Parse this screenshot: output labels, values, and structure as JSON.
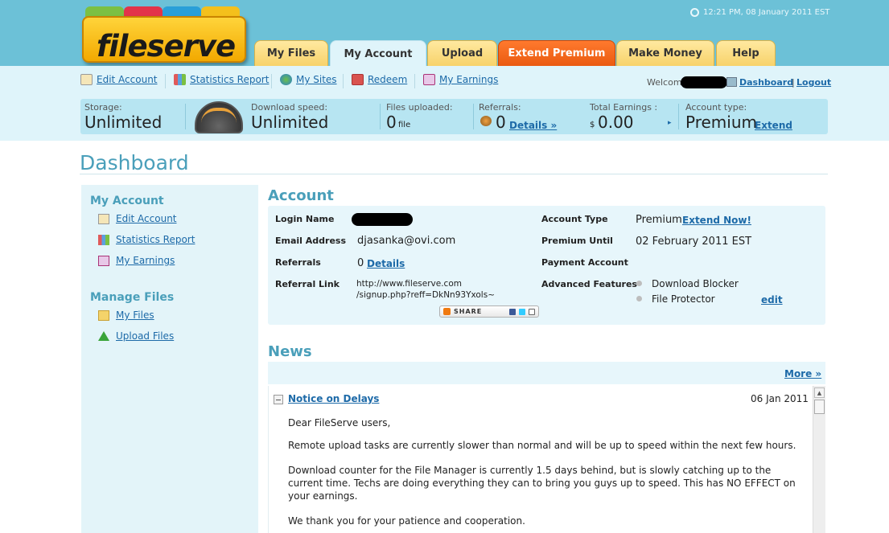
{
  "header": {
    "logo_text": "fileserve",
    "clock": "12:21 PM, 08 January 2011 EST",
    "tabs": [
      {
        "label": "My Files"
      },
      {
        "label": "My Account"
      },
      {
        "label": "Upload"
      },
      {
        "label": "Extend Premium"
      },
      {
        "label": "Make Money"
      },
      {
        "label": "Help"
      }
    ]
  },
  "subnav": {
    "links": [
      {
        "label": "Edit Account"
      },
      {
        "label": "Statistics Report"
      },
      {
        "label": "My Sites"
      },
      {
        "label": "Redeem"
      },
      {
        "label": "My Earnings"
      }
    ],
    "welcome": "Welcome",
    "dashboard": "Dashboard",
    "separator": "|",
    "logout": "Logout"
  },
  "stats": {
    "storage_label": "Storage:",
    "storage_value": "Unlimited",
    "speed_label": "Download speed:",
    "speed_value": "Unlimited",
    "files_label": "Files uploaded:",
    "files_value": "0",
    "files_unit": "file",
    "referrals_label": "Referrals:",
    "referrals_value": "0",
    "referrals_link": "Details »",
    "earnings_label": "Total Earnings :",
    "earnings_currency": "$",
    "earnings_value": "0.00",
    "earnings_arrow": "▸",
    "type_label": "Account type:",
    "type_value": "Premium",
    "type_link": "Extend"
  },
  "page": {
    "title": "Dashboard"
  },
  "sidebar": {
    "my_account_heading": "My Account",
    "my_account_links": [
      {
        "label": "Edit Account"
      },
      {
        "label": "Statistics Report"
      },
      {
        "label": "My Earnings"
      }
    ],
    "manage_files_heading": "Manage Files",
    "manage_files_links": [
      {
        "label": "My Files"
      },
      {
        "label": "Upload Files"
      }
    ]
  },
  "account": {
    "heading": "Account",
    "login_name_label": "Login Name",
    "email_label": "Email Address",
    "email_value": "djasanka@ovi.com",
    "referrals_label": "Referrals",
    "referrals_value": "0",
    "referrals_link": "Details",
    "referral_link_label": "Referral Link",
    "referral_link_line1": "http://www.fileserve.com",
    "referral_link_line2": "/signup.php?reff=DkNn93Yxols~",
    "share_label": "SHARE",
    "account_type_label": "Account Type",
    "account_type_value": "Premium",
    "account_type_link": "Extend Now!",
    "premium_until_label": "Premium Until",
    "premium_until_value": "02 February 2011 EST",
    "payment_account_label": "Payment Account",
    "advanced_features_label": "Advanced Features",
    "features": [
      "Download Blocker",
      "File Protector"
    ],
    "edit_link": "edit"
  },
  "news": {
    "heading": "News",
    "more_link": "More »",
    "item_title": "Notice on Delays",
    "item_date": "06 Jan 2011",
    "paragraphs": [
      "Dear FileServe users,",
      "Remote upload tasks are currently slower than normal and will be up to speed within the next few hours.",
      "Download counter for the File Manager is currently 1.5 days behind, but is slowly catching up to the current time. Techs are doing everything they can to bring you guys up to speed. This has NO EFFECT on your earnings.",
      "We thank you for your patience and cooperation."
    ]
  },
  "colors": {
    "header_bg": "#6cc1d7",
    "subnav_bg": "#dff4fa",
    "link": "#1d6aa8",
    "heading": "#4a9fba",
    "premium_tab": "#ea5a10"
  }
}
